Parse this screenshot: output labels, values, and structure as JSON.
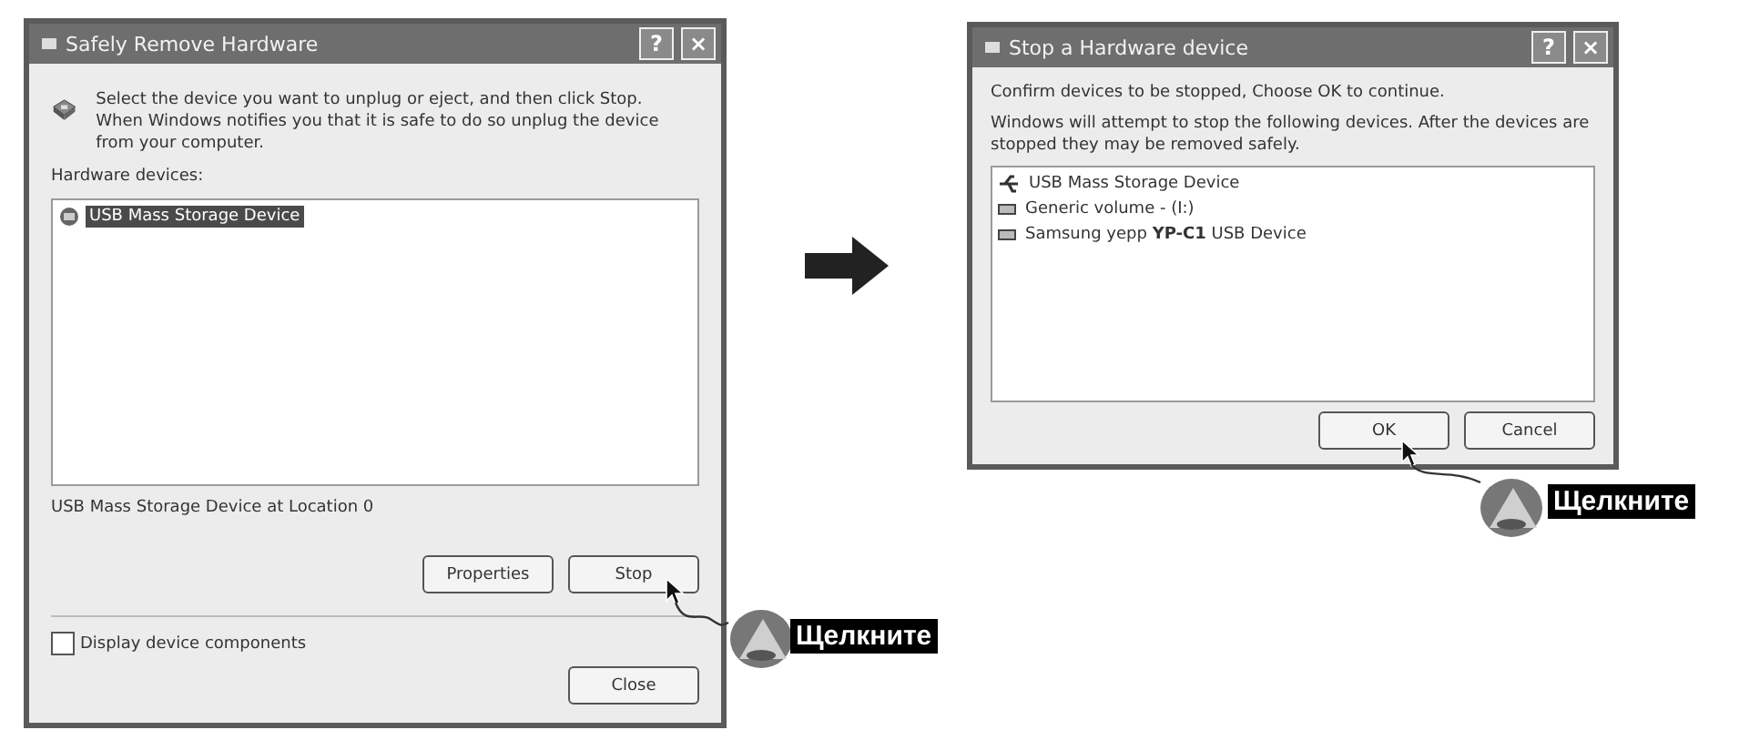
{
  "remove_dialog": {
    "title": "Safely Remove Hardware",
    "help_glyph": "?",
    "close_glyph": "×",
    "instruction": "Select the device you want to unplug or eject, and then click Stop. When Windows notifies you that it is safe to do so unplug the device from your computer.",
    "list_label": "Hardware devices:",
    "devices": [
      {
        "name": "USB Mass Storage Device",
        "selected": true
      }
    ],
    "location": "USB Mass Storage Device at Location 0",
    "buttons": [
      {
        "label": "Properties"
      },
      {
        "label": "Stop"
      }
    ],
    "checkbox": {
      "label": "Display device components",
      "checked": false
    },
    "close_button": "Close"
  },
  "stop_dialog": {
    "title": "Stop a Hardware device",
    "help_glyph": "?",
    "close_glyph": "×",
    "confirm": "Confirm devices to be stopped, Choose OK to continue.",
    "explanation": "Windows will attempt to stop the following devices. After the devices are stopped they may be removed safely.",
    "devices": [
      {
        "name": "USB Mass Storage Device",
        "kind": "device"
      },
      {
        "name": "Generic volume - (I:)",
        "kind": "volume"
      },
      {
        "name": "Samsung yepp **YP-C1** USB Device",
        "kind": "volume"
      }
    ],
    "buttons": [
      {
        "label": "OK"
      },
      {
        "label": "Cancel"
      }
    ]
  },
  "callouts": [
    {
      "label": "Щелкните"
    },
    {
      "label": "Щелкните"
    }
  ]
}
